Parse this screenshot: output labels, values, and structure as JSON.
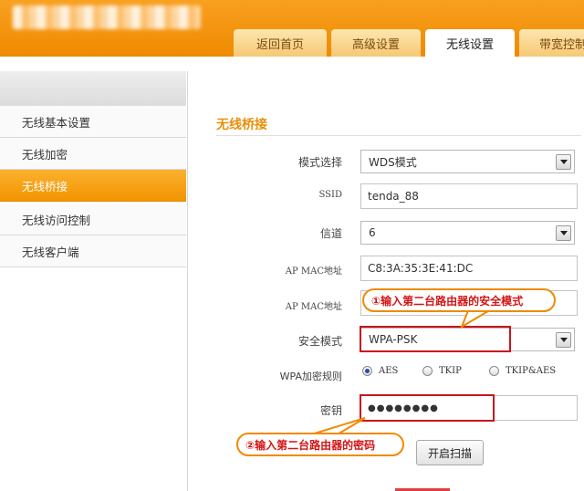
{
  "header": {
    "tabs": [
      {
        "label": "返回首页",
        "active": false
      },
      {
        "label": "高级设置",
        "active": false
      },
      {
        "label": "无线设置",
        "active": true
      },
      {
        "label": "带宽控制",
        "active": false
      }
    ]
  },
  "sidebar": {
    "items": [
      {
        "label": "无线基本设置",
        "active": false
      },
      {
        "label": "无线加密",
        "active": false
      },
      {
        "label": "无线桥接",
        "active": true
      },
      {
        "label": "无线访问控制",
        "active": false
      },
      {
        "label": "无线客户端",
        "active": false
      }
    ]
  },
  "main": {
    "title": "无线桥接",
    "fields": {
      "mode": {
        "label": "模式选择",
        "value": "WDS模式"
      },
      "ssid": {
        "label": "SSID",
        "value": "tenda_88"
      },
      "channel": {
        "label": "信道",
        "value": "6"
      },
      "ap_mac1": {
        "label": "AP MAC地址",
        "value": "C8:3A:35:3E:41:DC"
      },
      "ap_mac2": {
        "label": "AP MAC地址",
        "value": ""
      },
      "security_mode": {
        "label": "安全模式",
        "value": "WPA-PSK"
      },
      "wpa_rule": {
        "label": "WPA加密规则",
        "options": [
          "AES",
          "TKIP",
          "TKIP&AES"
        ],
        "selected": "AES"
      },
      "key": {
        "label": "密钥",
        "value": "●●●●●●●●"
      }
    },
    "scan_button": "开启扫描",
    "annotations": {
      "callout1": "①输入第二台路由器的安全模式",
      "callout2": "②输入第二台路由器的密码"
    }
  },
  "colors": {
    "accent": "#f29400",
    "callout_text": "#d41414",
    "highlight_border": "#c9151e"
  }
}
